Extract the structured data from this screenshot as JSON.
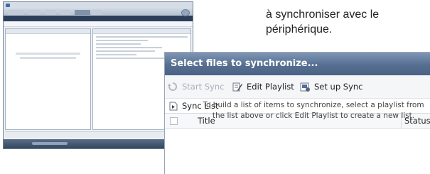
{
  "caption": {
    "line1": "à synchroniser avec le",
    "line2": "périphérique."
  },
  "dialog": {
    "title": "Select files to synchronize...",
    "toolbar": {
      "start_sync": "Start Sync",
      "edit_playlist": "Edit Playlist",
      "setup_sync": "Set up Sync"
    },
    "sync_list_label": "Sync List",
    "columns": {
      "title": "Title",
      "status": "Status"
    },
    "empty_message_line1": "To build a list of items to synchronize, select a playlist from",
    "empty_message_line2": "the list above or click Edit Playlist to create a new list."
  },
  "colors": {
    "title_bar": "#566f91",
    "disabled_text": "#aab0b8"
  },
  "icons": [
    "sync-icon",
    "edit-playlist-icon",
    "setup-sync-icon",
    "sync-list-icon",
    "checkbox-icon"
  ]
}
